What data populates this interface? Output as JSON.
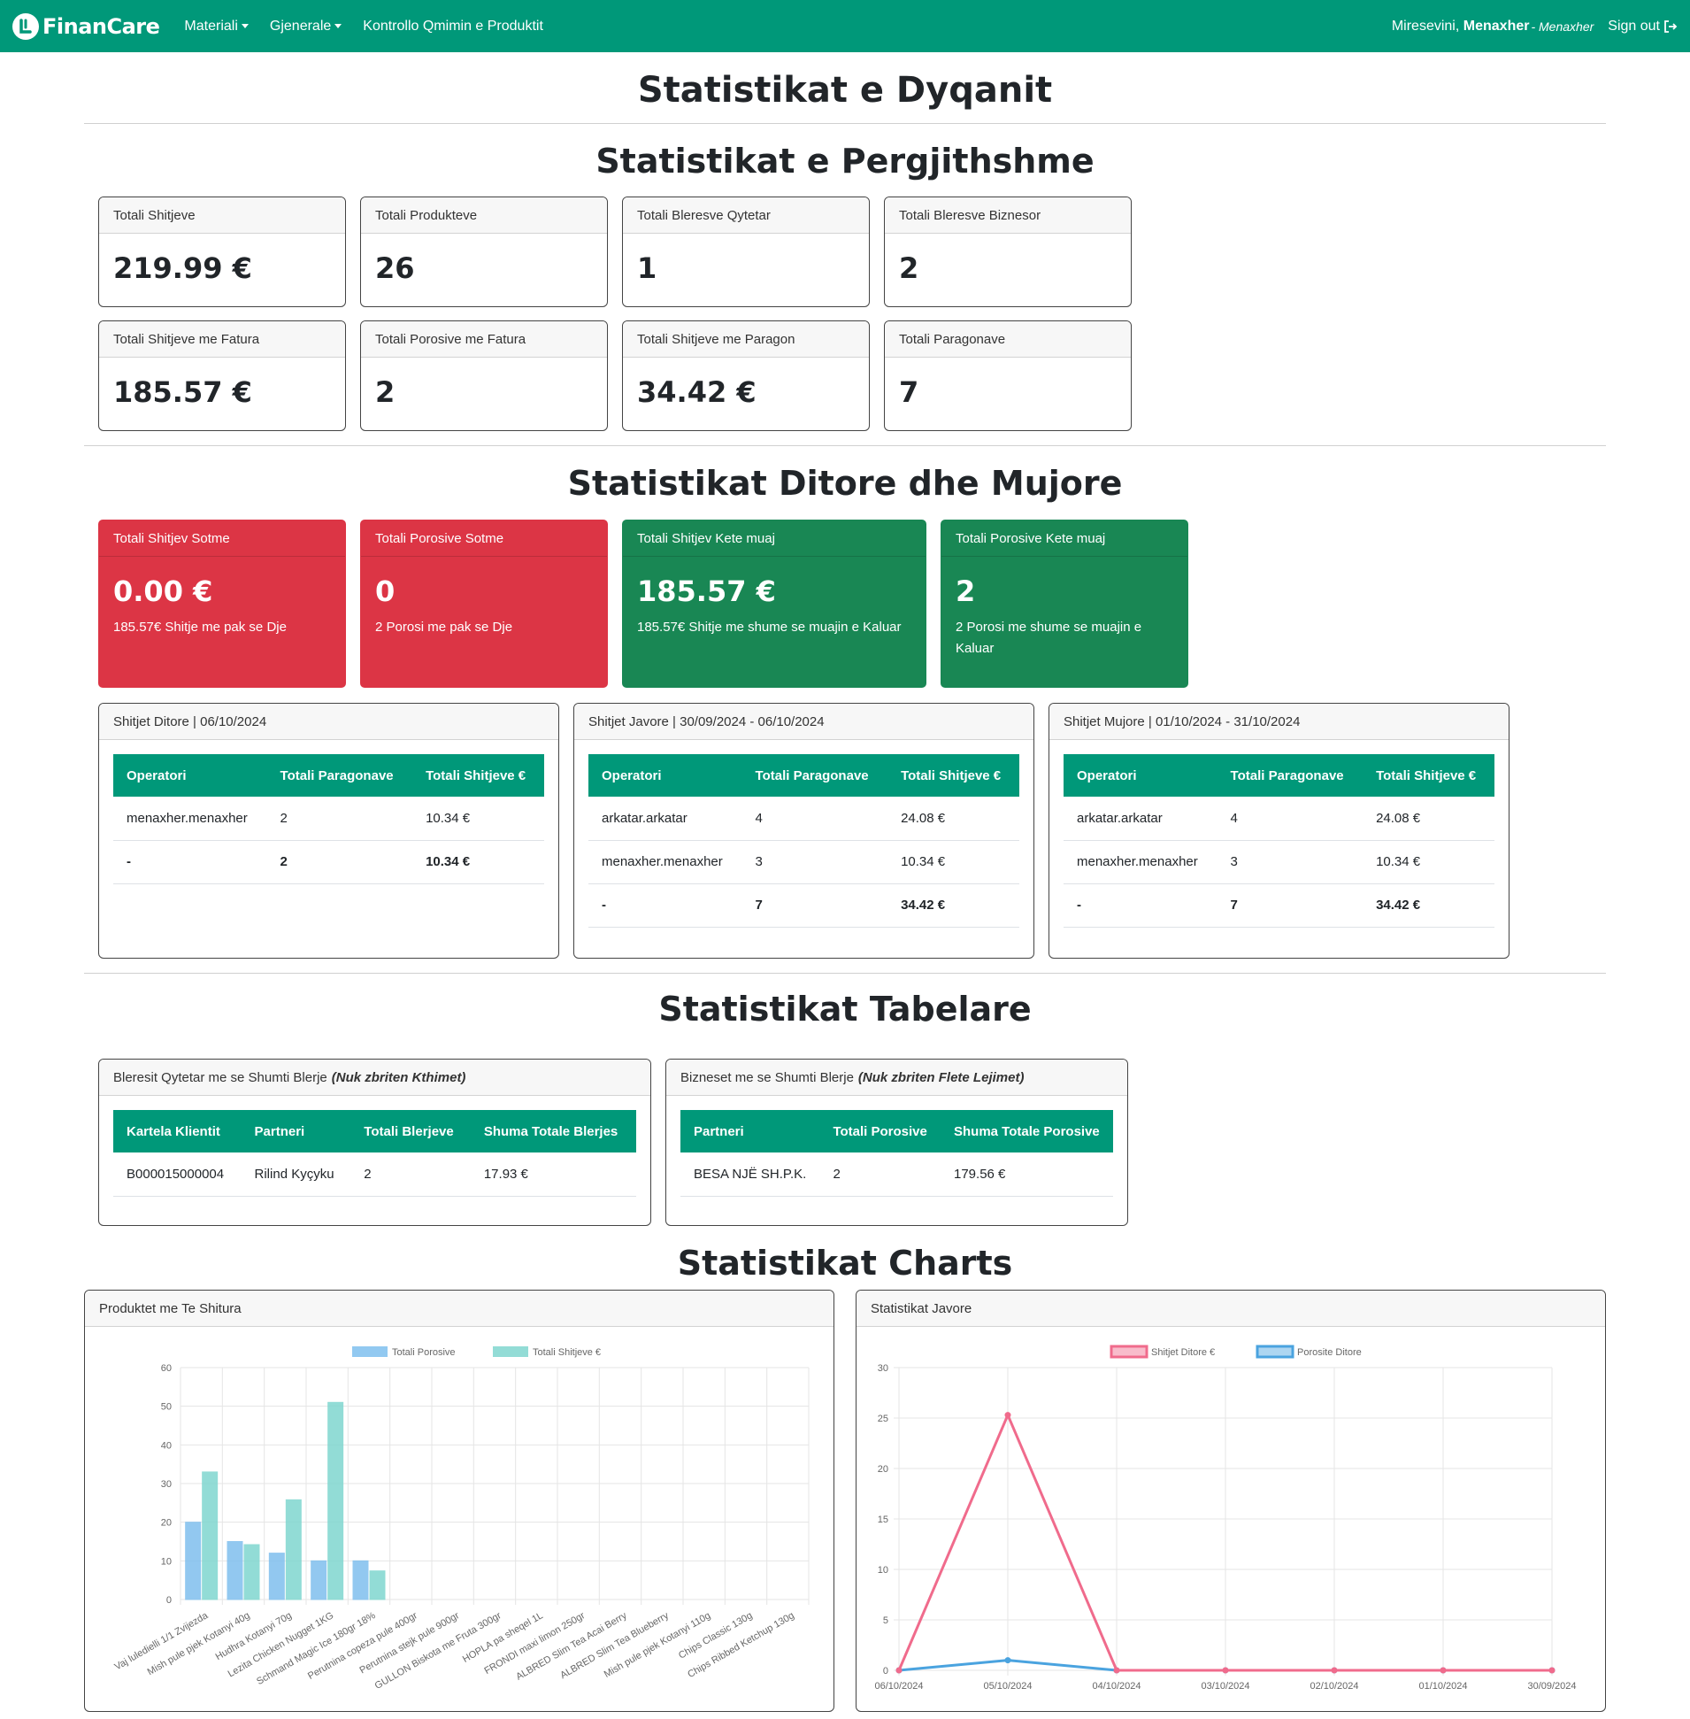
{
  "nav": {
    "brand": "FinanCare",
    "menu_materiali": "Materiali",
    "menu_gjenerale": "Gjenerale",
    "menu_kontrollo": "Kontrollo Qmimin e Produktit",
    "welcome_prefix": "Miresevini,",
    "user_name": "Menaxher",
    "role": "- Menaxher",
    "signout": "Sign out"
  },
  "page_title": "Statistikat e Dyqanit",
  "general": {
    "title": "Statistikat e Pergjithshme",
    "cards": [
      {
        "label": "Totali Shitjeve",
        "value": "219.99 €"
      },
      {
        "label": "Totali Produkteve",
        "value": "26"
      },
      {
        "label": "Totali Bleresve Qytetar",
        "value": "1"
      },
      {
        "label": "Totali Bleresve Biznesor",
        "value": "2"
      },
      {
        "label": "Totali Shitjeve me Fatura",
        "value": "185.57 €"
      },
      {
        "label": "Totali Porosive me Fatura",
        "value": "2"
      },
      {
        "label": "Totali Shitjeve me Paragon",
        "value": "34.42 €"
      },
      {
        "label": "Totali Paragonave",
        "value": "7"
      }
    ]
  },
  "daily_monthly": {
    "title": "Statistikat Ditore dhe Mujore",
    "cards": [
      {
        "label": "Totali Shitjev Sotme",
        "value": "0.00 €",
        "sub": "185.57€ Shitje me pak se Dje",
        "color": "#dc3545"
      },
      {
        "label": "Totali Porosive Sotme",
        "value": "0",
        "sub": "2 Porosi me pak se Dje",
        "color": "#dc3545"
      },
      {
        "label": "Totali Shitjev Kete muaj",
        "value": "185.57 €",
        "sub": "185.57€ Shitje me shume se muajin e Kaluar",
        "color": "#198754"
      },
      {
        "label": "Totali Porosive Kete muaj",
        "value": "2",
        "sub": "2 Porosi me shume se muajin e Kaluar",
        "color": "#198754"
      }
    ],
    "tables": [
      {
        "header": "Shitjet Ditore | 06/10/2024",
        "columns": [
          "Operatori",
          "Totali Paragonave",
          "Totali Shitjeve €"
        ],
        "rows": [
          [
            "menaxher.menaxher",
            "2",
            "10.34 €"
          ]
        ],
        "total": [
          "-",
          "2",
          "10.34 €"
        ]
      },
      {
        "header": "Shitjet Javore | 30/09/2024 - 06/10/2024",
        "columns": [
          "Operatori",
          "Totali Paragonave",
          "Totali Shitjeve €"
        ],
        "rows": [
          [
            "arkatar.arkatar",
            "4",
            "24.08 €"
          ],
          [
            "menaxher.menaxher",
            "3",
            "10.34 €"
          ]
        ],
        "total": [
          "-",
          "7",
          "34.42 €"
        ]
      },
      {
        "header": "Shitjet Mujore | 01/10/2024 - 31/10/2024",
        "columns": [
          "Operatori",
          "Totali Paragonave",
          "Totali Shitjeve €"
        ],
        "rows": [
          [
            "arkatar.arkatar",
            "4",
            "24.08 €"
          ],
          [
            "menaxher.menaxher",
            "3",
            "10.34 €"
          ]
        ],
        "total": [
          "-",
          "7",
          "34.42 €"
        ]
      }
    ]
  },
  "tabular": {
    "title": "Statistikat Tabelare",
    "citizens": {
      "header": "Bleresit Qytetar me se Shumti Blerje",
      "header_em": "(Nuk zbriten Kthimet)",
      "columns": [
        "Kartela Klientit",
        "Partneri",
        "Totali Blerjeve",
        "Shuma Totale Blerjes"
      ],
      "rows": [
        [
          "B000015000004",
          "Rilind Kyçyku",
          "2",
          "17.93 €"
        ]
      ]
    },
    "business": {
      "header": "Bizneset me se Shumti Blerje",
      "header_em": "(Nuk zbriten Flete Lejimet)",
      "columns": [
        "Partneri",
        "Totali Porosive",
        "Shuma Totale Porosive"
      ],
      "rows": [
        [
          "BESA NJË SH.P.K.",
          "2",
          "179.56 €"
        ]
      ]
    }
  },
  "charts_section": {
    "title": "Statistikat Charts",
    "products_header": "Produktet me Te Shitura",
    "weekly_header": "Statistikat Javore"
  },
  "chart_data": [
    {
      "type": "bar",
      "categories": [
        "Vaj luledielli 1/1 Zvijezda",
        "Mish pule pjek Kotanyi 40g",
        "Hudhra Kotanyi 70g",
        "Lezita Chicken Nugget 1KG",
        "Schmand Magic Ice 180gr 18%",
        "Perutnina copeza pule 400gr",
        "Perutnina stejk pule 900gr",
        "GULLON Biskota me Fruta 300gr",
        "HOPLA pa sheqel 1L",
        "FRONDI maxi limon 250gr",
        "ALBRED Slim Tea Acai Berry",
        "ALBRED Slim Tea Blueberry",
        "Mish pule pjek Kotanyi 110g",
        "Chips Classic 130g",
        "Chips Ribbed Ketchup 130g"
      ],
      "series": [
        {
          "name": "Totali Porosive",
          "color": "#7fbfee",
          "values": [
            20,
            15,
            12,
            10,
            10,
            null,
            null,
            null,
            null,
            null,
            null,
            null,
            null,
            null,
            null
          ]
        },
        {
          "name": "Totali Shitjeve €",
          "color": "#80d6cf",
          "values": [
            33,
            14.2,
            25.8,
            51,
            7.4,
            null,
            null,
            null,
            null,
            null,
            null,
            null,
            null,
            null,
            null
          ]
        }
      ],
      "ylim": [
        0,
        60
      ],
      "yticks": [
        0,
        10,
        20,
        30,
        40,
        50,
        60
      ],
      "legend": "top"
    },
    {
      "type": "line",
      "x": [
        "06/10/2024",
        "05/10/2024",
        "04/10/2024",
        "03/10/2024",
        "02/10/2024",
        "01/10/2024",
        "30/09/2024"
      ],
      "series": [
        {
          "name": "Shitjet Ditore €",
          "color": "#f06b8c",
          "values": [
            0,
            25.3,
            0,
            0,
            0,
            0,
            0
          ]
        },
        {
          "name": "Porosite Ditore",
          "color": "#4aa3df",
          "values": [
            0,
            1,
            0,
            0,
            0,
            0,
            0
          ]
        }
      ],
      "ylim": [
        0,
        30
      ],
      "yticks": [
        0,
        5,
        10,
        15,
        20,
        25,
        30
      ],
      "legend": "top"
    }
  ]
}
